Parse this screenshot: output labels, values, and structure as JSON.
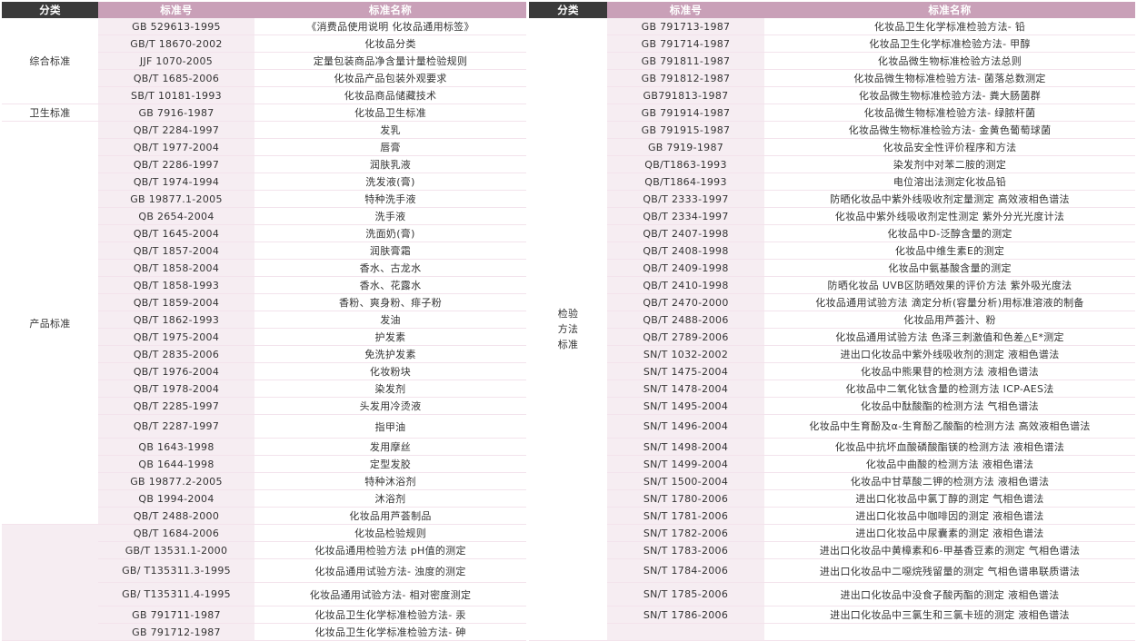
{
  "headers": {
    "left_category": "分类",
    "left_code": "标准号",
    "left_name": "标准名称",
    "right_category": "分类",
    "right_code": "标准号",
    "right_name": "标准名称"
  },
  "left_categories": [
    {
      "label": "综合标准",
      "span": 5
    },
    {
      "label": "卫生标准",
      "span": 1
    },
    {
      "label": "产品标准",
      "span": 23
    },
    {
      "label": "",
      "span": 6
    }
  ],
  "left_rows": [
    {
      "code": "GB 529613-1995",
      "name": "《消费品使用说明 化妆品通用标签》"
    },
    {
      "code": "GB/T 18670-2002",
      "name": "化妆品分类"
    },
    {
      "code": "JJF 1070-2005",
      "name": "定量包装商品净含量计量检验规则"
    },
    {
      "code": "QB/T 1685-2006",
      "name": "化妆品产品包装外观要求"
    },
    {
      "code": "SB/T 10181-1993",
      "name": "化妆品商品储藏技术"
    },
    {
      "code": "GB 7916-1987",
      "name": "化妆品卫生标准"
    },
    {
      "code": "QB/T 2284-1997",
      "name": "发乳"
    },
    {
      "code": "QB/T 1977-2004",
      "name": "唇膏"
    },
    {
      "code": "QB/T 2286-1997",
      "name": "润肤乳液"
    },
    {
      "code": "QB/T 1974-1994",
      "name": "洗发液(膏)"
    },
    {
      "code": "GB 19877.1-2005",
      "name": "特种洗手液"
    },
    {
      "code": "QB 2654-2004",
      "name": "洗手液"
    },
    {
      "code": "QB/T 1645-2004",
      "name": "洗面奶(膏)"
    },
    {
      "code": "QB/T 1857-2004",
      "name": "润肤膏霜"
    },
    {
      "code": "QB/T 1858-2004",
      "name": "香水、古龙水"
    },
    {
      "code": "QB/T 1858-1993",
      "name": "香水、花露水"
    },
    {
      "code": "QB/T 1859-2004",
      "name": "香粉、爽身粉、痱子粉"
    },
    {
      "code": "QB/T 1862-1993",
      "name": "发油"
    },
    {
      "code": "QB/T 1975-2004",
      "name": "护发素"
    },
    {
      "code": "QB/T 2835-2006",
      "name": "免洗护发素"
    },
    {
      "code": "QB/T 1976-2004",
      "name": "化妆粉块"
    },
    {
      "code": "QB/T 1978-2004",
      "name": "染发剂"
    },
    {
      "code": "QB/T 2285-1997",
      "name": "头发用冷烫液"
    },
    {
      "code": "QB/T 2287-1997",
      "name": "指甲油"
    },
    {
      "code": "QB 1643-1998",
      "name": "发用摩丝"
    },
    {
      "code": "QB 1644-1998",
      "name": "定型发胶"
    },
    {
      "code": "GB 19877.2-2005",
      "name": "特种沐浴剂"
    },
    {
      "code": "QB 1994-2004",
      "name": "沐浴剂"
    },
    {
      "code": "QB/T 2488-2000",
      "name": "化妆品用芦荟制品"
    },
    {
      "code": "QB/T 1684-2006",
      "name": "化妆品检验规则"
    },
    {
      "code": "GB/T 13531.1-2000",
      "name": "化妆品通用检验方法 pH值的测定"
    },
    {
      "code": "GB/ T135311.3-1995",
      "name": "化妆品通用试验方法- 浊度的测定"
    },
    {
      "code": "GB/ T135311.4-1995",
      "name": "化妆品通用试验方法- 相对密度测定"
    },
    {
      "code": "GB 791711-1987",
      "name": "化妆品卫生化学标准检验方法- 汞"
    },
    {
      "code": "GB 791712-1987",
      "name": "化妆品卫生化学标准检验方法- 砷"
    }
  ],
  "right_category": "检验\n方法\n标准",
  "right_rows": [
    {
      "code": "GB 791713-1987",
      "name": "化妆品卫生化学标准检验方法- 铅"
    },
    {
      "code": "GB 791714-1987",
      "name": "化妆品卫生化学标准检验方法- 甲醇"
    },
    {
      "code": "GB 791811-1987",
      "name": "化妆品微生物标准检验方法总则"
    },
    {
      "code": "GB 791812-1987",
      "name": "化妆品微生物标准检验方法- 菌落总数测定"
    },
    {
      "code": "GB791813-1987",
      "name": "化妆品微生物标准检验方法- 粪大肠菌群"
    },
    {
      "code": "GB 791914-1987",
      "name": "化妆品微生物标准检验方法- 绿脓杆菌"
    },
    {
      "code": "GB 791915-1987",
      "name": "化妆品微生物标准检验方法- 金黄色葡萄球菌"
    },
    {
      "code": "GB 7919-1987",
      "name": "化妆品安全性评价程序和方法"
    },
    {
      "code": "QB/T1863-1993",
      "name": "染发剂中对苯二胺的测定"
    },
    {
      "code": "QB/T1864-1993",
      "name": "电位溶出法测定化妆品铅"
    },
    {
      "code": "QB/T 2333-1997",
      "name": "防晒化妆品中紫外线吸收剂定量测定 高效液相色谱法"
    },
    {
      "code": "QB/T 2334-1997",
      "name": "化妆品中紫外线吸收剂定性测定 紫外分光光度计法"
    },
    {
      "code": "QB/T 2407-1998",
      "name": "化妆品中D-泛醇含量的测定"
    },
    {
      "code": "QB/T 2408-1998",
      "name": "化妆品中维生素E的测定"
    },
    {
      "code": "QB/T 2409-1998",
      "name": "化妆品中氨基酸含量的测定"
    },
    {
      "code": "QB/T 2410-1998",
      "name": "防晒化妆品 UVB区防晒效果的评价方法 紫外吸光度法"
    },
    {
      "code": "QB/T 2470-2000",
      "name": "化妆品通用试验方法 滴定分析(容量分析)用标准溶液的制备"
    },
    {
      "code": "QB/T 2488-2006",
      "name": "化妆品用芦荟汁、粉"
    },
    {
      "code": "QB/T 2789-2006",
      "name": "化妆品通用试验方法 色泽三刺激值和色差△E*测定"
    },
    {
      "code": "SN/T 1032-2002",
      "name": "进出口化妆品中紫外线吸收剂的测定 液相色谱法"
    },
    {
      "code": "SN/T 1475-2004",
      "name": "化妆品中熊果苷的检测方法 液相色谱法"
    },
    {
      "code": "SN/T 1478-2004",
      "name": "化妆品中二氧化钛含量的检测方法 ICP-AES法"
    },
    {
      "code": "SN/T 1495-2004",
      "name": "化妆品中酞酸酯的检测方法 气相色谱法"
    },
    {
      "code": "SN/T 1496-2004",
      "name": "化妆品中生育酚及α-生育酚乙酸酯的检测方法 高效液相色谱法"
    },
    {
      "code": "SN/T 1498-2004",
      "name": "化妆品中抗坏血酸磷酸酯镁的检测方法 液相色谱法"
    },
    {
      "code": "SN/T 1499-2004",
      "name": "化妆品中曲酸的检测方法 液相色谱法"
    },
    {
      "code": "SN/T 1500-2004",
      "name": "化妆品中甘草酸二钾的检测方法 液相色谱法"
    },
    {
      "code": "SN/T 1780-2006",
      "name": "进出口化妆品中氯丁醇的测定 气相色谱法"
    },
    {
      "code": "SN/T 1781-2006",
      "name": "进出口化妆品中咖啡因的测定 液相色谱法"
    },
    {
      "code": "SN/T 1782-2006",
      "name": "进出口化妆品中尿囊素的测定 液相色谱法"
    },
    {
      "code": "SN/T 1783-2006",
      "name": "进出口化妆品中黄樟素和6-甲基香豆素的测定 气相色谱法"
    },
    {
      "code": "SN/T 1784-2006",
      "name": "进出口化妆品中二噁烷残留量的测定 气相色谱串联质谱法"
    },
    {
      "code": "SN/T 1785-2006",
      "name": "进出口化妆品中没食子酸丙酯的测定 液相色谱法"
    },
    {
      "code": "SN/T 1786-2006",
      "name": "进出口化妆品中三氯生和三氯卡班的测定 液相色谱法"
    }
  ]
}
